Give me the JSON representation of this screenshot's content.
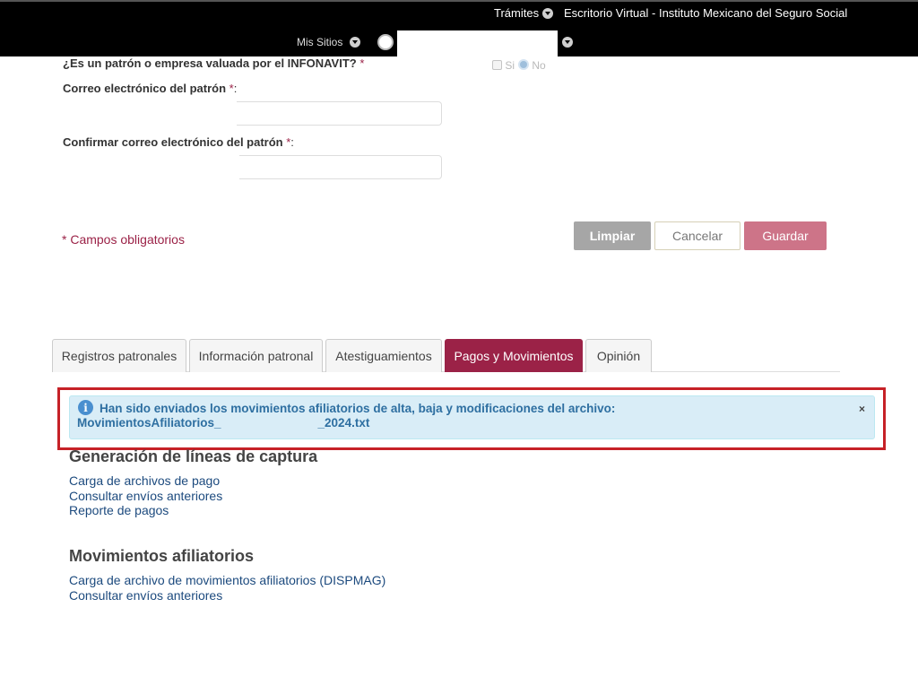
{
  "topbar": {
    "tramites": "Trámites",
    "site_title": "Escritorio Virtual - Instituto Mexicano del Seguro Social",
    "mis_sitios": "Mis Sitios"
  },
  "form": {
    "infonavit_question": "¿Es un patrón o empresa valuada por el INFONAVIT? ",
    "infonavit_options": {
      "si": "Si",
      "no": "No",
      "selected": "No"
    },
    "email_label": "Correo electrónico del patrón ",
    "email_value": "",
    "confirm_email_label": "Confirmar correo electrónico del patrón ",
    "confirm_email_value": "",
    "required_marker": "*",
    "colon": ":",
    "required_note": "* Campos obligatorios"
  },
  "buttons": {
    "clear": "Limpiar",
    "cancel": "Cancelar",
    "save": "Guardar"
  },
  "tabs": [
    {
      "label": "Registros patronales",
      "active": false
    },
    {
      "label": "Información patronal",
      "active": false
    },
    {
      "label": "Atestiguamientos",
      "active": false
    },
    {
      "label": "Pagos y Movimientos",
      "active": true
    },
    {
      "label": "Opinión",
      "active": false
    }
  ],
  "alert": {
    "message": "Han sido enviados los movimientos afiliatorios de alta, baja y modificaciones del archivo:",
    "filename_prefix": "MovimientosAfiliatorios_",
    "filename_suffix": "_2024.txt",
    "close": "×"
  },
  "sections": {
    "payments": {
      "title": "Generación de líneas de captura",
      "links": [
        "Carga de archivos de pago",
        "Consultar envíos anteriores",
        "Reporte de pagos"
      ]
    },
    "movements": {
      "title": "Movimientos afiliatorios",
      "links": [
        "Carga de archivo de movimientos afiliatorios (DISPMAG)",
        "Consultar envíos anteriores"
      ]
    }
  },
  "colors": {
    "brand": "#9b2247",
    "save_button": "#cd7488",
    "info_bg": "#d9edf7",
    "highlight": "#c62127"
  }
}
